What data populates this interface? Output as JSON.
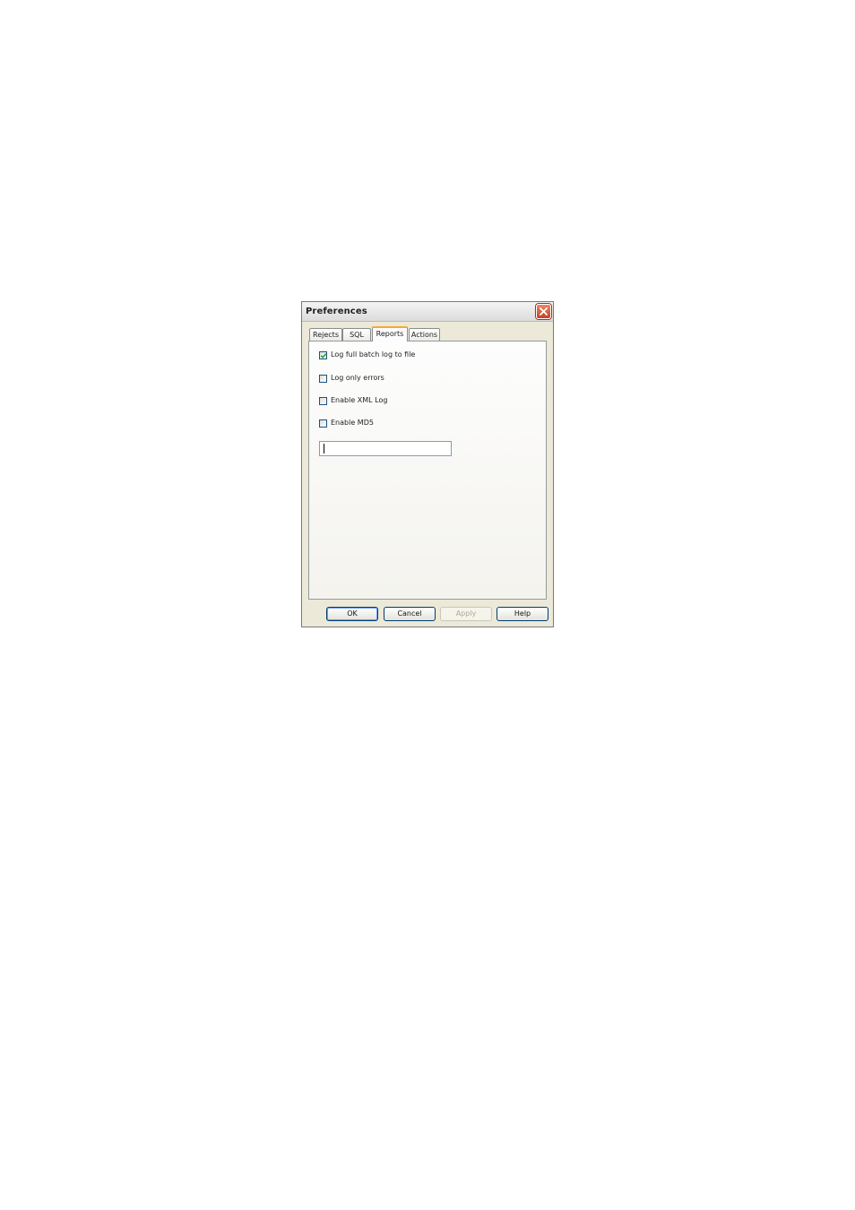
{
  "window": {
    "title": "Preferences"
  },
  "tabs": [
    {
      "label": "Rejects",
      "active": false
    },
    {
      "label": "SQL",
      "active": false
    },
    {
      "label": "Reports",
      "active": true
    },
    {
      "label": "Actions",
      "active": false
    }
  ],
  "options": [
    {
      "label": "Log full batch log to file",
      "checked": true
    },
    {
      "label": "Log only errors",
      "checked": false
    },
    {
      "label": "Enable XML Log",
      "checked": false
    },
    {
      "label": "Enable MD5",
      "checked": false
    }
  ],
  "text_field": {
    "value": ""
  },
  "buttons": {
    "ok": "OK",
    "cancel": "Cancel",
    "apply": "Apply",
    "help": "Help"
  },
  "icons": {
    "close": "close-icon",
    "check": "checkmark-icon"
  },
  "colors": {
    "active_tab_accent": "#f3a93a",
    "close_button": "#c8401e",
    "checkmark": "#21a121"
  }
}
